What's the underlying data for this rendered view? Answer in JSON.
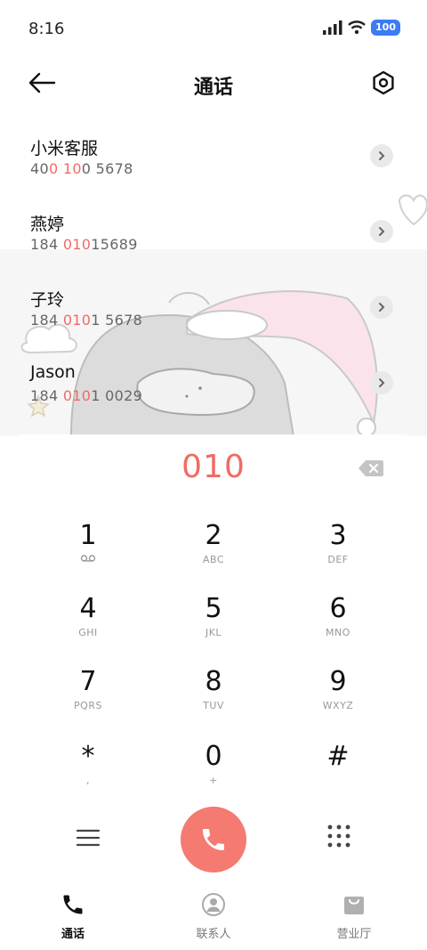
{
  "status": {
    "time": "8:16",
    "battery": "100"
  },
  "header": {
    "title": "通话"
  },
  "results": [
    {
      "name": "小米客服",
      "num_parts": [
        "40",
        "0 10",
        "0 5678"
      ]
    },
    {
      "name": "燕婷",
      "num_parts": [
        "184 ",
        "010",
        "15689"
      ]
    },
    {
      "name": "子玲",
      "num_parts": [
        "184 ",
        "010",
        "1 5678"
      ]
    },
    {
      "name": "Jason",
      "num_parts": [
        "184 ",
        "010",
        "1 0029"
      ]
    }
  ],
  "dial": {
    "input": "010"
  },
  "keys": [
    {
      "digit": "1",
      "sub": ""
    },
    {
      "digit": "2",
      "sub": "ABC"
    },
    {
      "digit": "3",
      "sub": "DEF"
    },
    {
      "digit": "4",
      "sub": "GHI"
    },
    {
      "digit": "5",
      "sub": "JKL"
    },
    {
      "digit": "6",
      "sub": "MNO"
    },
    {
      "digit": "7",
      "sub": "PQRS"
    },
    {
      "digit": "8",
      "sub": "TUV"
    },
    {
      "digit": "9",
      "sub": "WXYZ"
    },
    {
      "digit": "*",
      "sub": ","
    },
    {
      "digit": "0",
      "sub": "+"
    },
    {
      "digit": "#",
      "sub": ""
    }
  ],
  "nav": [
    {
      "label": "通话",
      "icon": "phone-icon"
    },
    {
      "label": "联系人",
      "icon": "contacts-icon"
    },
    {
      "label": "营业厅",
      "icon": "store-bag-icon"
    }
  ],
  "colors": {
    "accent": "#f06b66",
    "call": "#f47a72",
    "battery": "#3b7bf5"
  }
}
